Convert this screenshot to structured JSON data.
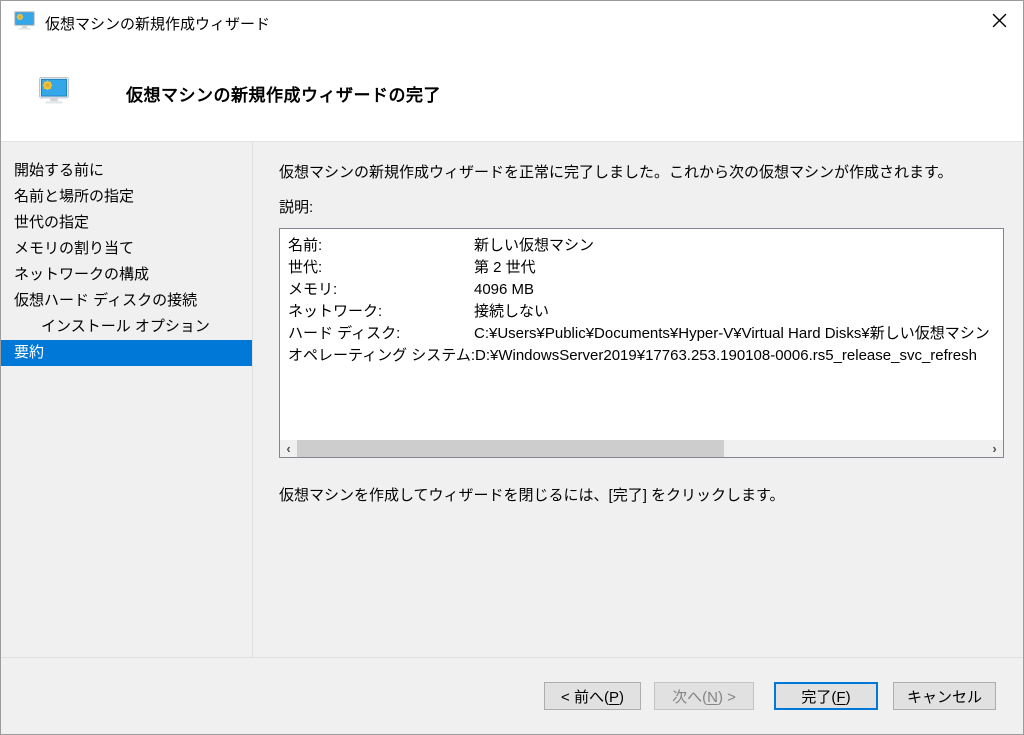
{
  "titlebar": {
    "title": "仮想マシンの新規作成ウィザード"
  },
  "header": {
    "title": "仮想マシンの新規作成ウィザードの完了"
  },
  "sidebar": {
    "items": [
      {
        "label": "開始する前に"
      },
      {
        "label": "名前と場所の指定"
      },
      {
        "label": "世代の指定"
      },
      {
        "label": "メモリの割り当て"
      },
      {
        "label": "ネットワークの構成"
      },
      {
        "label": "仮想ハード ディスクの接続"
      },
      {
        "label": "インストール オプション"
      },
      {
        "label": "要約"
      }
    ]
  },
  "main": {
    "intro": "仮想マシンの新規作成ウィザードを正常に完了しました。これから次の仮想マシンが作成されます。",
    "description_label": "説明:",
    "note": "仮想マシンを作成してウィザードを閉じるには、[完了] をクリックします。"
  },
  "summary": {
    "rows": [
      {
        "label": "名前:",
        "value": "新しい仮想マシン"
      },
      {
        "label": "世代:",
        "value": "第 2 世代"
      },
      {
        "label": "メモリ:",
        "value": "4096 MB"
      },
      {
        "label": "ネットワーク:",
        "value": "接続しない"
      },
      {
        "label": "ハード ディスク:",
        "value": "C:¥Users¥Public¥Documents¥Hyper-V¥Virtual Hard Disks¥新しい仮想マシン"
      },
      {
        "label": "オペレーティング システム:",
        "value": "D:¥WindowsServer2019¥17763.253.190108-0006.rs5_release_svc_refresh"
      }
    ]
  },
  "buttons": {
    "back": {
      "prefix": "< 前へ(",
      "key": "P",
      "suffix": ")"
    },
    "next": {
      "prefix": "次へ(",
      "key": "N",
      "suffix": ") >"
    },
    "finish": {
      "prefix": "完了(",
      "key": "F",
      "suffix": ")"
    },
    "cancel": {
      "label": "キャンセル"
    }
  },
  "icons": {
    "scroll_left": "‹",
    "scroll_right": "›"
  },
  "colors": {
    "accent": "#0078d7",
    "selected_nav_bg": "#0078d7",
    "button_bg": "#e1e1e1"
  }
}
